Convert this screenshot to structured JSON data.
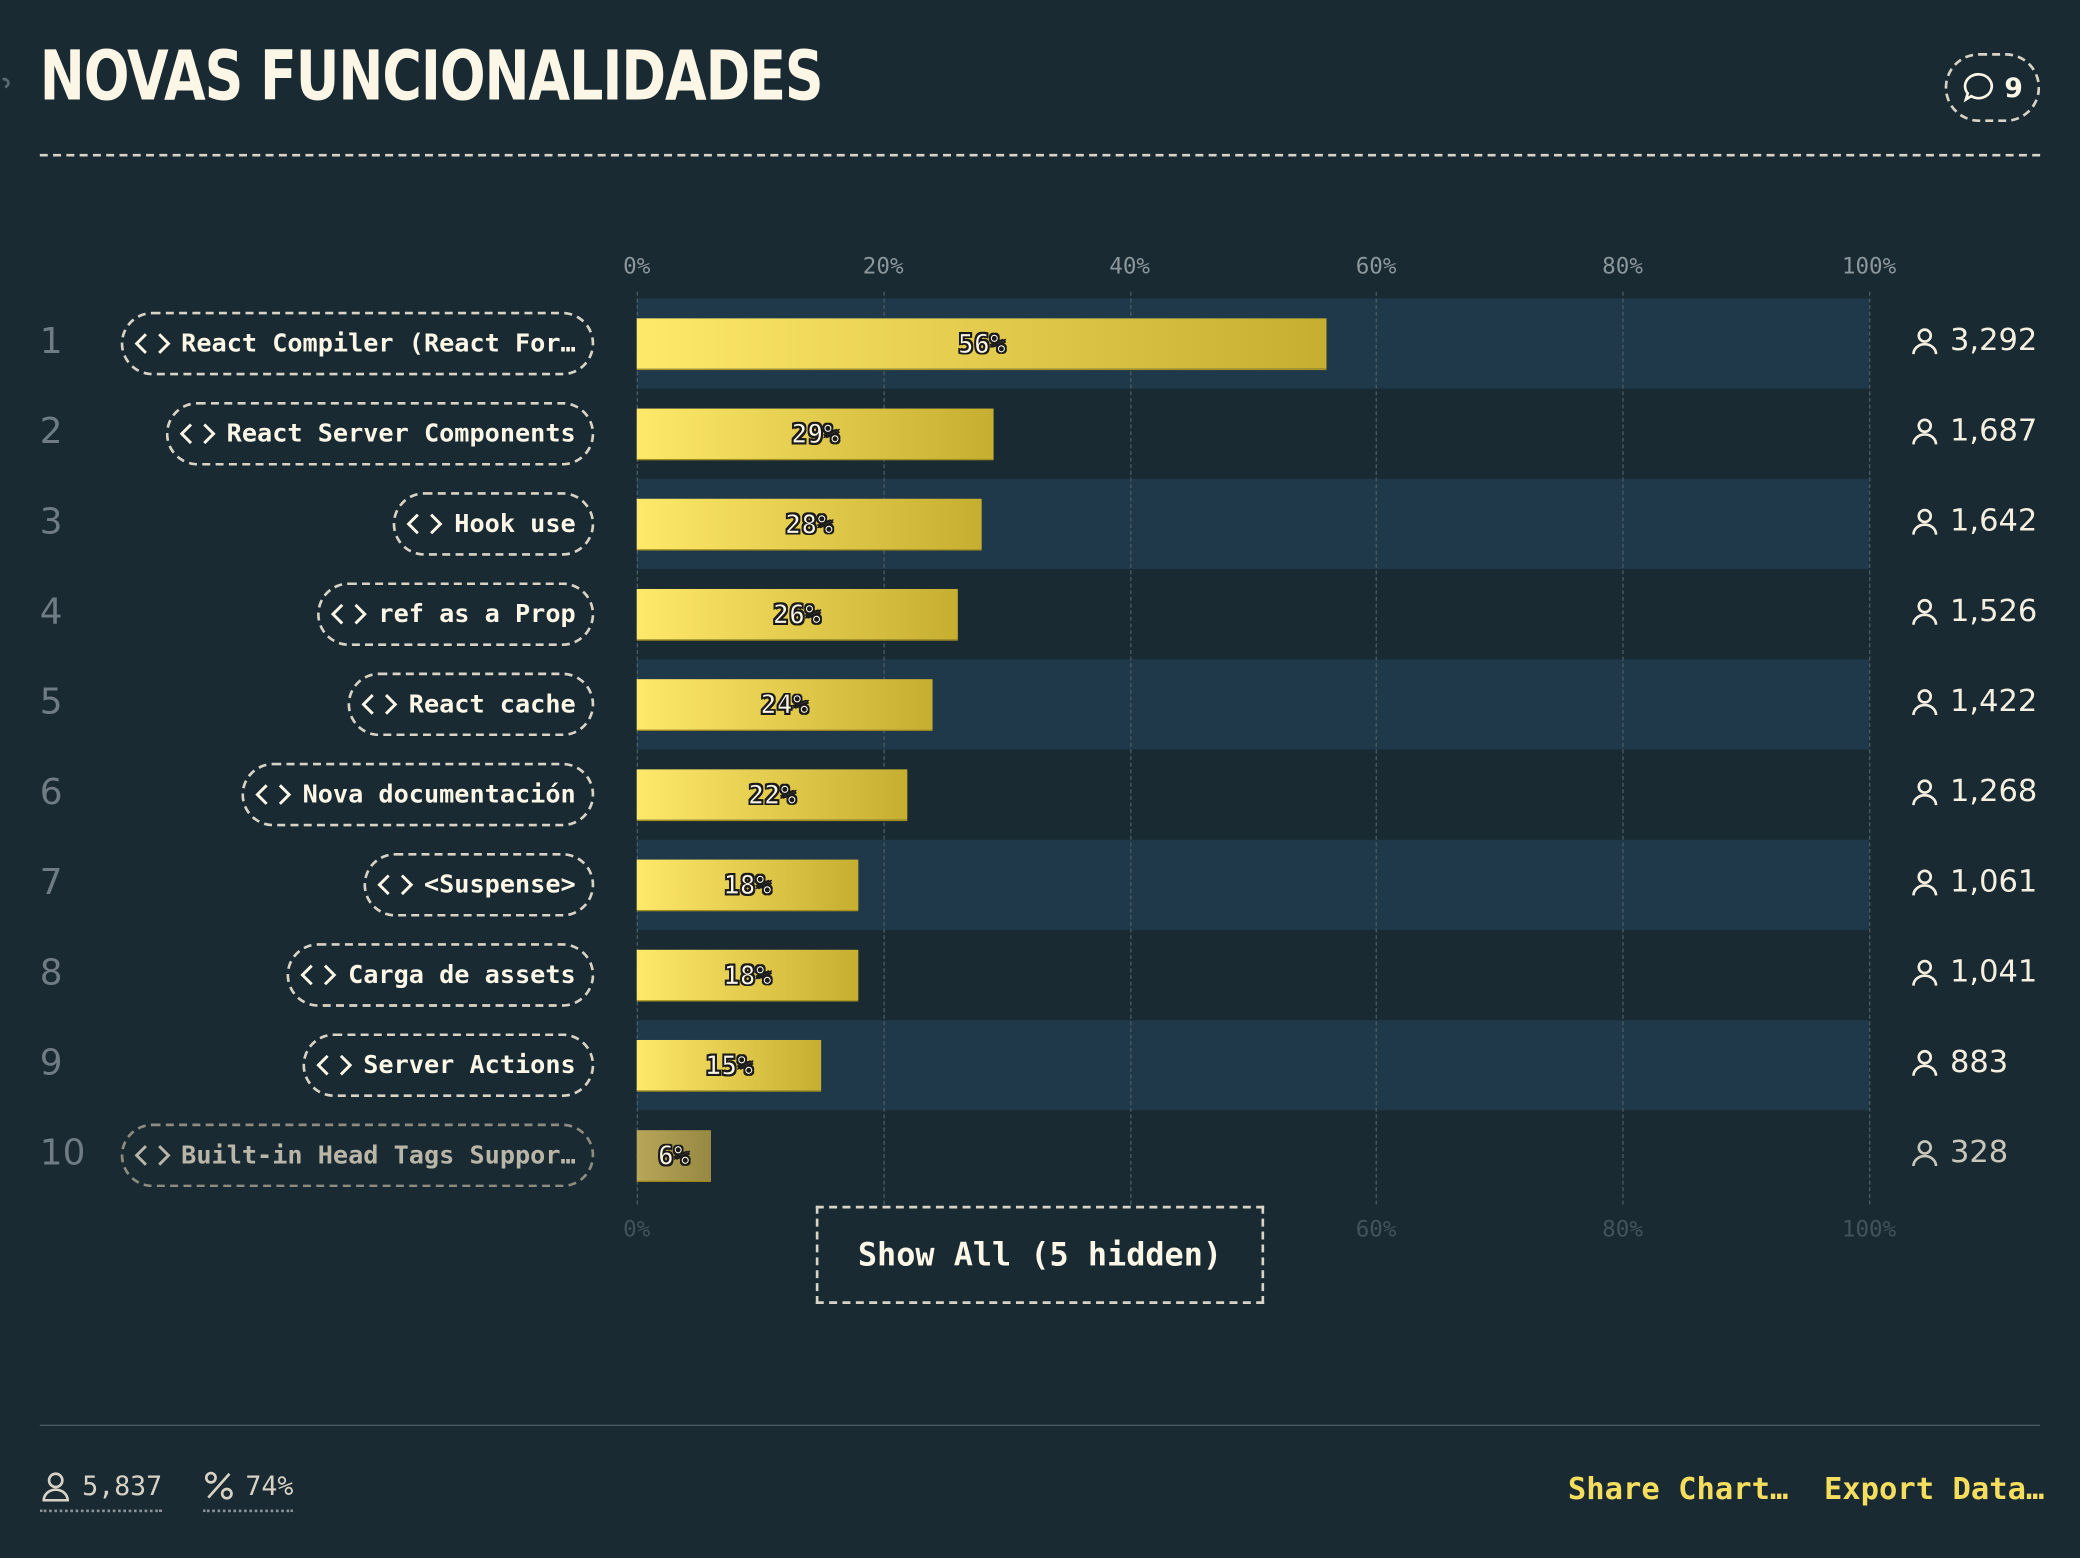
{
  "header": {
    "title": "NOVAS FUNCIONALIDADES",
    "comment_count": "9"
  },
  "chart_data": {
    "type": "bar",
    "orientation": "horizontal",
    "title": "NOVAS FUNCIONALIDADES",
    "xlim": [
      0,
      100
    ],
    "x_ticks": [
      "0%",
      "20%",
      "40%",
      "60%",
      "80%",
      "100%"
    ],
    "grid": true,
    "ranks": [
      "1",
      "2",
      "3",
      "4",
      "5",
      "6",
      "7",
      "8",
      "9",
      "10"
    ],
    "categories": [
      "React Compiler (React For…",
      "React Server Components",
      "Hook use",
      "ref as a Prop",
      "React cache",
      "Nova documentación",
      "<Suspense>",
      "Carga de assets",
      "Server Actions",
      "Built-in Head Tags Suppor…"
    ],
    "values": [
      56,
      29,
      28,
      26,
      24,
      22,
      18,
      18,
      15,
      6
    ],
    "value_labels": [
      "56%",
      "29%",
      "28%",
      "26%",
      "24%",
      "22%",
      "18%",
      "18%",
      "15%",
      "6%"
    ],
    "counts": [
      "3,292",
      "1,687",
      "1,642",
      "1,526",
      "1,422",
      "1,268",
      "1,061",
      "1,041",
      "883",
      "328"
    ],
    "bar_color_start": "#ffe96a",
    "bar_color_end": "#c6ae30"
  },
  "show_all_label": "Show All (5 hidden)",
  "footer": {
    "respondents": "5,837",
    "percent": "74%",
    "share_label": "Share Chart…",
    "export_label": "Export Data…"
  }
}
